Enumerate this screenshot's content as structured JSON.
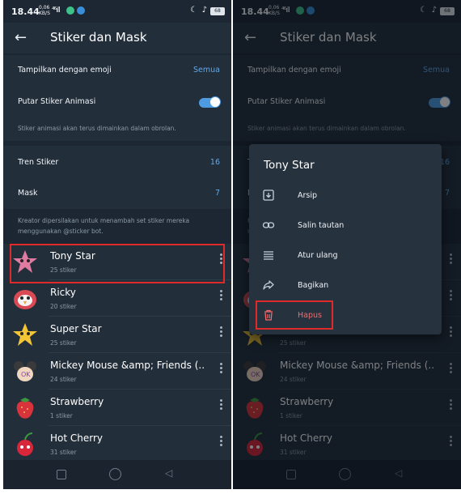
{
  "status": {
    "time": "18.44",
    "net_top": "0,06",
    "net_bottom": "KB/S",
    "signal": "⁴⁶ıll",
    "battery": "68"
  },
  "appbar": {
    "title": "Stiker dan Mask"
  },
  "settings": {
    "emoji_label": "Tampilkan dengan emoji",
    "emoji_value": "Semua",
    "animated_label": "Putar Stiker Animasi",
    "animated_hint": "Stiker animasi akan terus dimainkan dalam obrolan.",
    "trending_label": "Tren Stiker",
    "trending_value": "16",
    "masks_label": "Mask",
    "masks_value": "7",
    "creator_hint": "Kreator dipersilakan untuk menambah set stiker mereka menggunakan @sticker bot."
  },
  "packs": [
    {
      "name": "Tony Star",
      "count": "25 stiker"
    },
    {
      "name": "Ricky",
      "count": "20 stiker"
    },
    {
      "name": "Super Star",
      "count": "25 stiker"
    },
    {
      "name": "Mickey Mouse &amp; Friends (...",
      "count": "24 stiker"
    },
    {
      "name": "Strawberry",
      "count": "1 stiker"
    },
    {
      "name": "Hot Cherry",
      "count": "31 stiker"
    }
  ],
  "menu": {
    "title": "Tony Star",
    "items": [
      {
        "label": "Arsip",
        "icon": "archive-icon"
      },
      {
        "label": "Salin tautan",
        "icon": "link-icon"
      },
      {
        "label": "Atur ulang",
        "icon": "reorder-icon"
      },
      {
        "label": "Bagikan",
        "icon": "share-icon"
      },
      {
        "label": "Hapus",
        "icon": "delete-icon"
      }
    ]
  },
  "colors": {
    "background": "#1d2733",
    "accent": "#5fa8e8",
    "highlight": "#e02a2a",
    "danger": "#f26a6a"
  }
}
